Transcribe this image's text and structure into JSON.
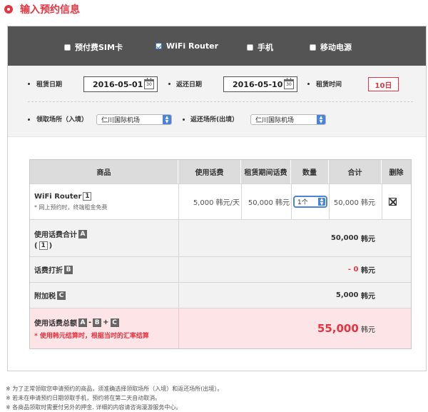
{
  "title": "输入预约信息",
  "types": [
    {
      "label": "预付费SIM卡",
      "checked": false
    },
    {
      "label": "WiFi Router",
      "checked": true
    },
    {
      "label": "手机",
      "checked": false
    },
    {
      "label": "移动电源",
      "checked": false
    }
  ],
  "filters": {
    "rent_date_label": "租赁日期",
    "rent_date": "2016-05-01",
    "return_date_label": "返还日期",
    "return_date": "2016-05-10",
    "rent_time_label": "租赁时间",
    "rent_days": "10日",
    "pickup_label": "领取场所（入境）",
    "pickup_value": "仁川国际机场",
    "return_place_label": "返还场所(出境）",
    "return_place_value": "仁川国际机场",
    "calendar_glyph": "30"
  },
  "table": {
    "headers": [
      "商品",
      "使用话费",
      "租赁期间话费",
      "数量",
      "合计",
      "删除"
    ],
    "item": {
      "name": "WiFi Router",
      "badge": "1",
      "note": "* 网上预约时，终端租金免费",
      "fee": "5,000 韩元/天",
      "period_fee": "50,000 韩元",
      "qty": "1个",
      "total": "50,000 韩元"
    },
    "subtotal": {
      "label": "使用话费合计",
      "badge": "A",
      "ref_open": "(",
      "ref_badge": "1",
      "ref_close": ")",
      "value": "50,000",
      "unit": "韩元"
    },
    "discount": {
      "label": "话费打折",
      "badge": "B",
      "value": "- 0",
      "unit": "韩元"
    },
    "tax": {
      "label": "附加税",
      "badge": "C",
      "value": "5,000",
      "unit": "韩元"
    },
    "grand": {
      "label": "使用话费总额",
      "formula_a": "A",
      "op1": "-",
      "formula_b": "B",
      "op2": "+",
      "formula_c": "C",
      "note": "* 使用韩元结算时，根据当时的汇率结算",
      "value": "55,000",
      "unit": "韩元"
    }
  },
  "notes": [
    "※ 为了正常领取您申请预约的商品，须准确选择领取场所（入境）和返还场所(出境）。",
    "※ 若未在申请预约日期领取手机，预约将在第二天自动取消。",
    "※ 各商品领取时需要付另外的押金. 详细的内容请咨询漫游服务中心。"
  ],
  "colors": {
    "accent": "#e8343f",
    "select_blue": "#4a84d9",
    "bar": "#545454",
    "pink": "#fde4e7"
  }
}
